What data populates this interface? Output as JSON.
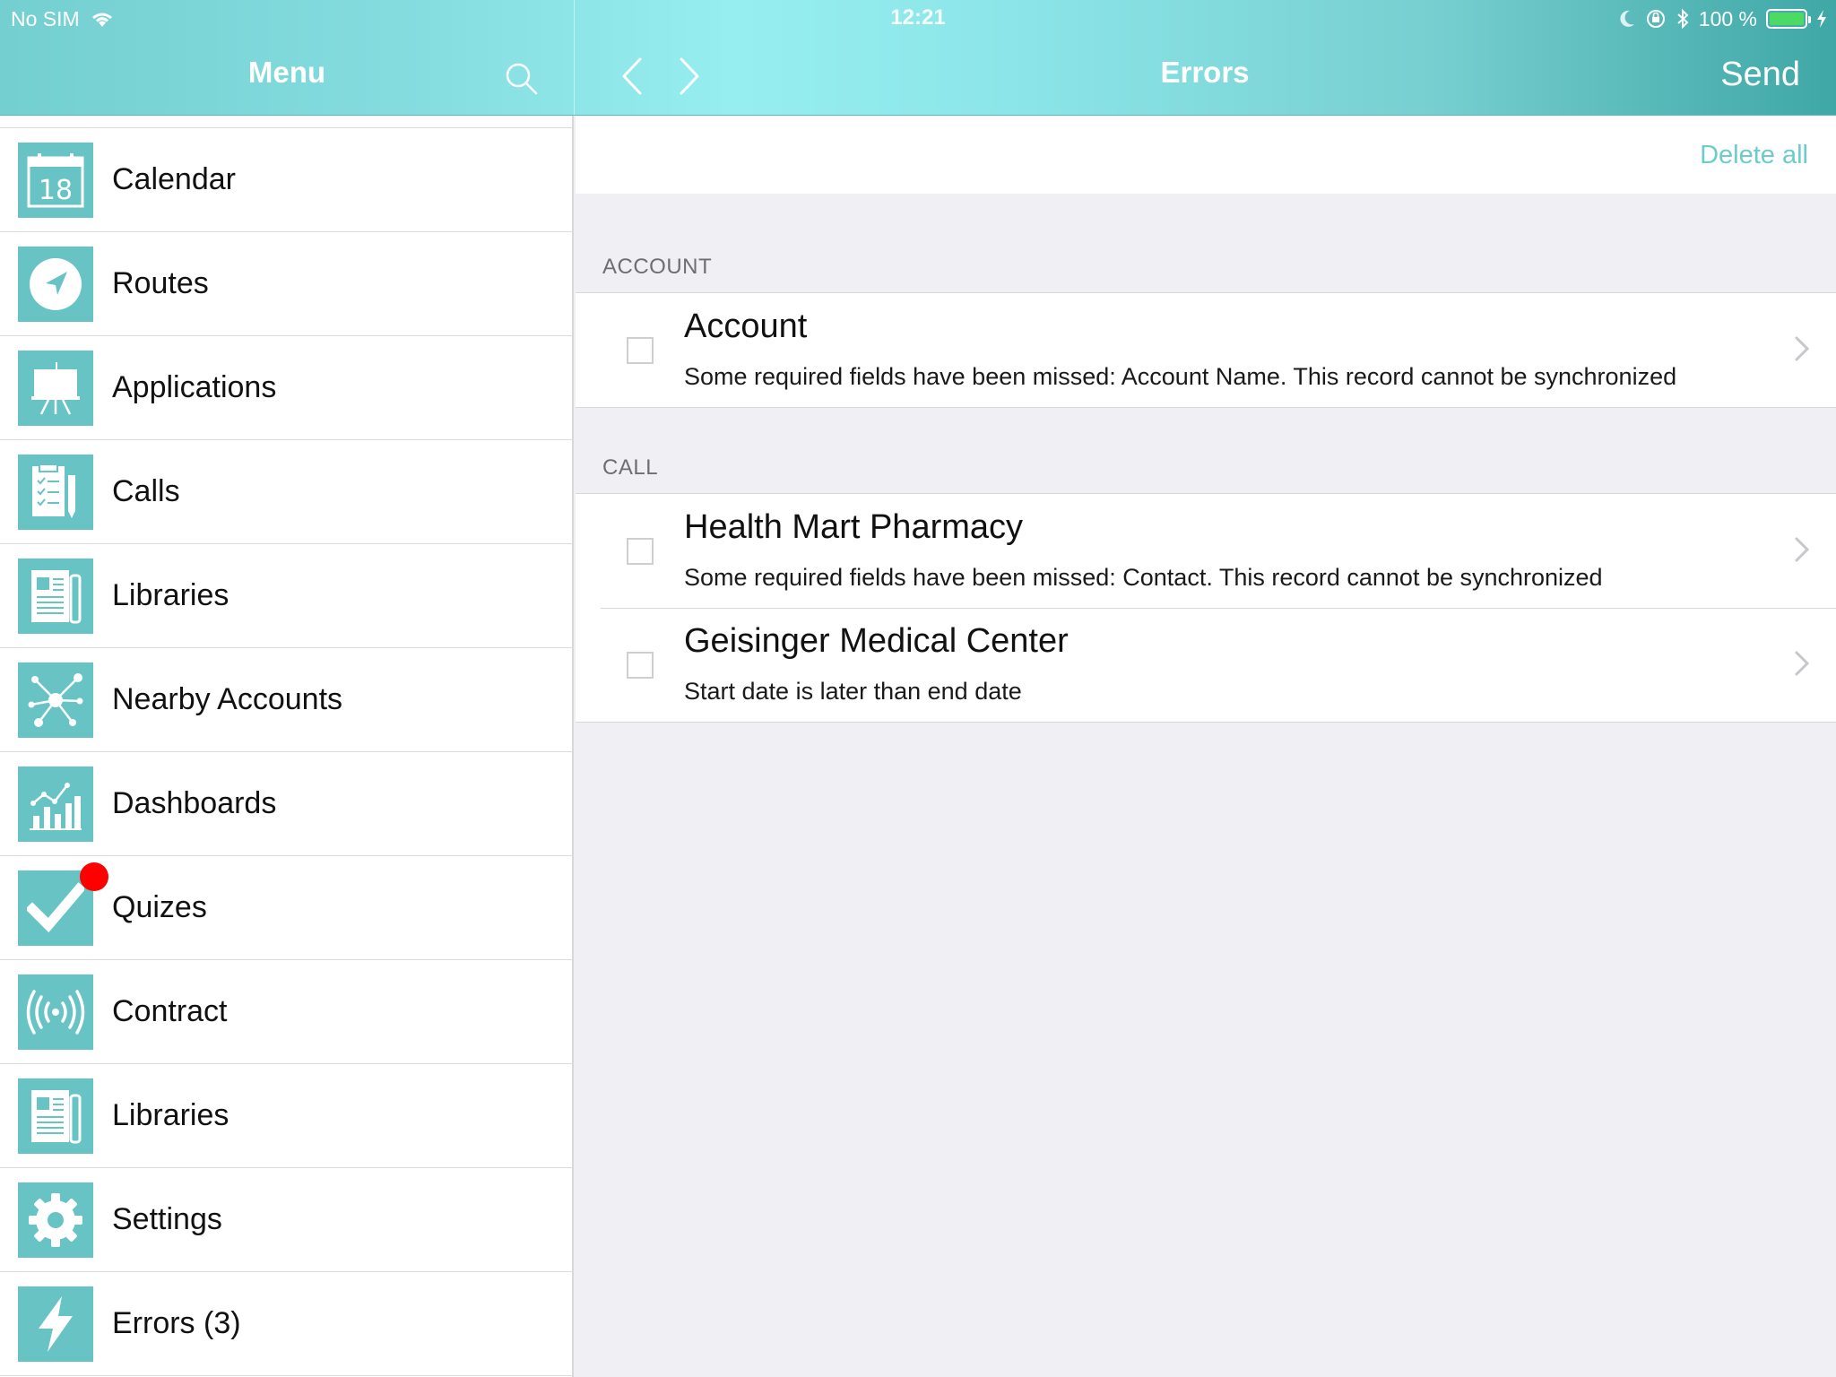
{
  "status_bar": {
    "carrier": "No SIM",
    "time": "12:21",
    "battery_percent": "100 %"
  },
  "sidebar": {
    "title": "Menu",
    "items": [
      {
        "label": "Calendar",
        "icon": "calendar-icon",
        "icon_text": "18"
      },
      {
        "label": "Routes",
        "icon": "compass-icon"
      },
      {
        "label": "Applications",
        "icon": "presentation-icon"
      },
      {
        "label": "Calls",
        "icon": "clipboard-icon"
      },
      {
        "label": "Libraries",
        "icon": "newspaper-icon"
      },
      {
        "label": "Nearby Accounts",
        "icon": "network-icon"
      },
      {
        "label": "Dashboards",
        "icon": "chart-icon"
      },
      {
        "label": "Quizes",
        "icon": "checkmark-icon",
        "badge": true
      },
      {
        "label": "Contract",
        "icon": "broadcast-icon"
      },
      {
        "label": "Libraries",
        "icon": "newspaper-icon"
      },
      {
        "label": "Settings",
        "icon": "gear-icon"
      },
      {
        "label": "Errors (3)",
        "icon": "lightning-icon"
      }
    ]
  },
  "main": {
    "title": "Errors",
    "send_label": "Send",
    "delete_all_label": "Delete all",
    "sections": [
      {
        "header": "ACCOUNT",
        "rows": [
          {
            "title": "Account",
            "subtitle": "Some required fields have been missed: Account Name. This record cannot be synchronized"
          }
        ]
      },
      {
        "header": "CALL",
        "rows": [
          {
            "title": "Health Mart Pharmacy",
            "subtitle": "Some required fields have been missed: Contact. This record cannot be synchronized"
          },
          {
            "title": "Geisinger Medical Center",
            "subtitle": "Start date is later than end date"
          }
        ]
      }
    ]
  },
  "colors": {
    "accent": "#67c3c4",
    "link": "#6ccccc",
    "badge": "#ff0000",
    "battery": "#4cd964"
  }
}
